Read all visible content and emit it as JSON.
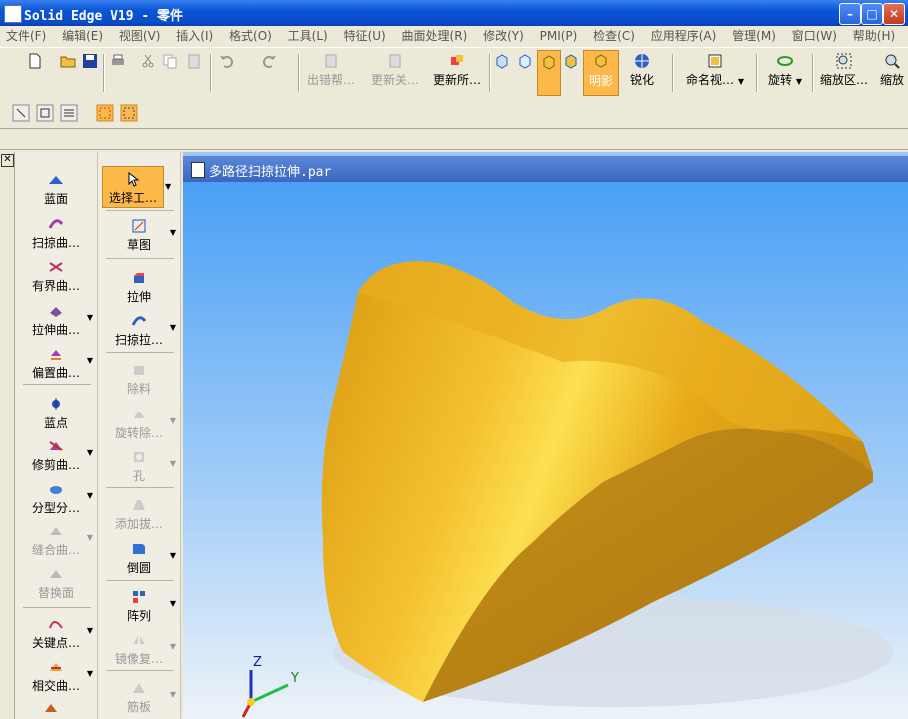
{
  "window": {
    "title": "Solid Edge V19 - 零件",
    "minimize": "–",
    "maximize": "□",
    "close": "✕"
  },
  "menu": [
    "文件(F)",
    "编辑(E)",
    "视图(V)",
    "插入(I)",
    "格式(O)",
    "工具(L)",
    "特征(U)",
    "曲面处理(R)",
    "修改(Y)",
    "PMI(P)",
    "检查(C)",
    "应用程序(A)",
    "管理(M)",
    "窗口(W)",
    "帮助(H)"
  ],
  "toolbar": {
    "error_helper": "出错帮…",
    "update_related": "更新关…",
    "update_all": "更新所…",
    "shaded": "明影",
    "sharpen": "锐化",
    "named_views": "命名视…",
    "rotate": "旋转",
    "zoom_area": "缩放区…",
    "zoom": "缩放"
  },
  "palette_surface": [
    {
      "label": "蓝面"
    },
    {
      "label": "扫掠曲…"
    },
    {
      "label": "有界曲…"
    },
    {
      "label": "拉伸曲…"
    },
    {
      "label": "偏置曲…"
    },
    {
      "label": "蓝点"
    },
    {
      "label": "修剪曲…"
    },
    {
      "label": "分型分…"
    },
    {
      "label": "缝合曲…"
    },
    {
      "label": "替换面"
    },
    {
      "label": "关键点…"
    },
    {
      "label": "相交曲…"
    }
  ],
  "palette_features": [
    {
      "label": "选择工…"
    },
    {
      "label": "草图"
    },
    {
      "label": "拉伸"
    },
    {
      "label": "扫掠拉…"
    },
    {
      "label": "除料"
    },
    {
      "label": "旋转除…"
    },
    {
      "label": "孔"
    },
    {
      "label": "添加拔…"
    },
    {
      "label": "倒圆"
    },
    {
      "label": "阵列"
    },
    {
      "label": "镜像复…"
    },
    {
      "label": "筋板"
    }
  ],
  "document": {
    "title": "多路径扫掠拉伸.par"
  },
  "triad": {
    "z": "Z",
    "y": "Y"
  },
  "colors": {
    "part": "#f0b020",
    "viewport_top": "#5aa8f5",
    "viewport_bottom": "#e8f0f8",
    "highlight": "#fdb84a"
  }
}
